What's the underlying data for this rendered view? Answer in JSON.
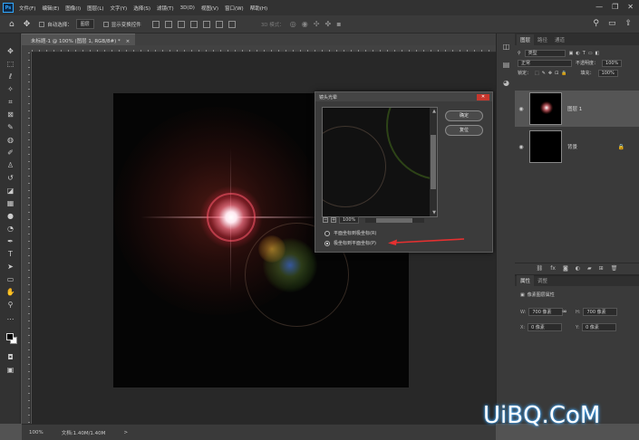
{
  "app": {
    "logo": "Ps"
  },
  "menu": [
    "文件(F)",
    "编辑(E)",
    "图像(I)",
    "图层(L)",
    "文字(Y)",
    "选择(S)",
    "滤镜(T)",
    "3D(D)",
    "视图(V)",
    "窗口(W)",
    "帮助(H)"
  ],
  "window_controls": [
    "—",
    "❐",
    "✕"
  ],
  "options": {
    "auto_select_label": "自动选择：",
    "auto_select_value": "图层",
    "transform_label": "显示变换控件",
    "mode_3d": "3D 模式："
  },
  "document": {
    "tab_title": "未标题-1 @ 100% (图层 1, RGB/8#) *",
    "tab_close": "×"
  },
  "dialog": {
    "title": "镜头光晕",
    "close": "✕",
    "ok": "确定",
    "reset": "复位",
    "zoom": "100%",
    "zoom_minus": "−",
    "zoom_plus": "+",
    "options": [
      "平面坐标到极坐标(R)",
      "极坐标到平面坐标(P)"
    ],
    "selected_option": 1
  },
  "layers_panel": {
    "tabs": [
      "图层",
      "路径",
      "通道"
    ],
    "kind_filter": "类型",
    "blend_mode": "正常",
    "opacity_label": "不透明度：",
    "opacity": "100%",
    "lock_label": "锁定：",
    "fill_label": "填充：",
    "fill": "100%",
    "layers": [
      {
        "name": "图层 1",
        "selected": true
      },
      {
        "name": "背景",
        "selected": false,
        "locked": true
      }
    ],
    "footer_icons": [
      "link-icon",
      "fx-icon",
      "mask-icon",
      "adjustment-icon",
      "group-icon",
      "new-layer-icon",
      "trash-icon"
    ]
  },
  "properties_panel": {
    "tabs": [
      "属性",
      "调整"
    ],
    "title": "像素图层属性",
    "w_label": "W:",
    "w_value": "700 像素",
    "h_label": "H:",
    "h_value": "700 像素",
    "x_label": "X:",
    "x_value": "0 像素",
    "y_label": "Y:",
    "y_value": "0 像素",
    "link": "∞"
  },
  "status": {
    "zoom": "100%",
    "doc_size": "文档:1.40M/1.40M",
    "arrow": ">"
  },
  "watermark": "UiBQ.CoM"
}
